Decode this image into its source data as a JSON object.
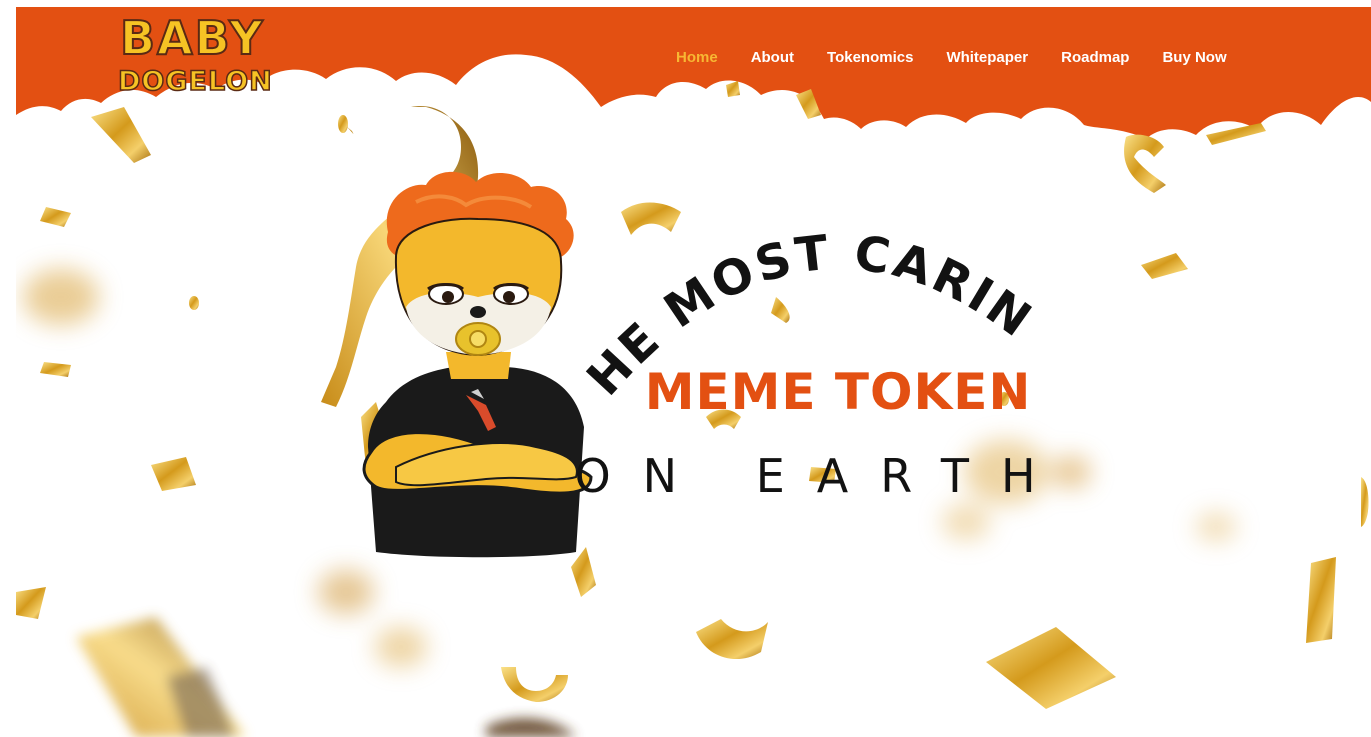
{
  "brand": {
    "logo_line1": "BABY",
    "logo_line2": "DOGELON",
    "header_color": "#e35012",
    "accent_color": "#f7b733"
  },
  "nav": {
    "items": [
      {
        "label": "Home",
        "active": true
      },
      {
        "label": "About",
        "active": false
      },
      {
        "label": "Tokenomics",
        "active": false
      },
      {
        "label": "Whitepaper",
        "active": false
      },
      {
        "label": "Roadmap",
        "active": false
      },
      {
        "label": "Buy Now",
        "active": false
      }
    ]
  },
  "hero": {
    "line1": "THE MOST CARING",
    "line2": "MEME TOKEN",
    "line3": "ON EARTH",
    "line2_color": "#e35012",
    "mascot": "shiba-baby-mascot-with-pacifier",
    "decoration": "gold-confetti-ribbons"
  }
}
